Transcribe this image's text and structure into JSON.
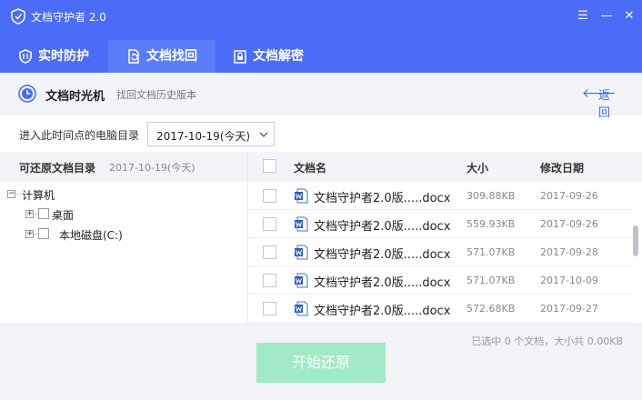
{
  "window": {
    "title": "文档守护者 2.0",
    "controls": [
      "☰",
      "—",
      "✕"
    ]
  },
  "tabs": [
    {
      "label": "实时防护",
      "icon": "shield-icon",
      "active": false
    },
    {
      "label": "文档找回",
      "icon": "document-restore-icon",
      "active": true
    },
    {
      "label": "文档解密",
      "icon": "lock-document-icon",
      "active": false
    }
  ],
  "subheader": {
    "title": "文档时光机",
    "subtitle": "找回文档历史版本",
    "back_label": "返回",
    "back_arrow": "🡐"
  },
  "directory": {
    "label": "进入此时间点的电脑目录",
    "selected_date": "2017-10-19(今天)"
  },
  "left_pane": {
    "header": "可还原文档目录",
    "header_date": "2017-10-19(今天)",
    "tree": [
      {
        "label": "计算机",
        "expander": "−",
        "level": 0
      },
      {
        "label": "桌面",
        "expander": "+",
        "level": 1
      },
      {
        "label": "本地磁盘(C:)",
        "expander": "+",
        "level": 1
      }
    ]
  },
  "file_table": {
    "columns": {
      "name": "文档名",
      "size": "大小",
      "date": "修改日期"
    },
    "rows": [
      {
        "name": "文档守护者2.0版.....docx",
        "size": "309.88KB",
        "date": "2017-09-26"
      },
      {
        "name": "文档守护者2.0版.....docx",
        "size": "559.93KB",
        "date": "2017-09-26"
      },
      {
        "name": "文档守护者2.0版.....docx",
        "size": "571.07KB",
        "date": "2017-09-28"
      },
      {
        "name": "文档守护者2.0版.....docx",
        "size": "571.07KB",
        "date": "2017-10-09"
      },
      {
        "name": "文档守护者2.0版.....docx",
        "size": "572.68KB",
        "date": "2017-09-27"
      }
    ]
  },
  "footer": {
    "selection_info": "已选中 0 个文档，大小共 0.00KB",
    "start_button": "开始还原"
  },
  "colors": {
    "header_blue": "#4a6cf7",
    "accent_blue": "#3b6df6",
    "button_green_disabled": "#a2e9c6"
  }
}
